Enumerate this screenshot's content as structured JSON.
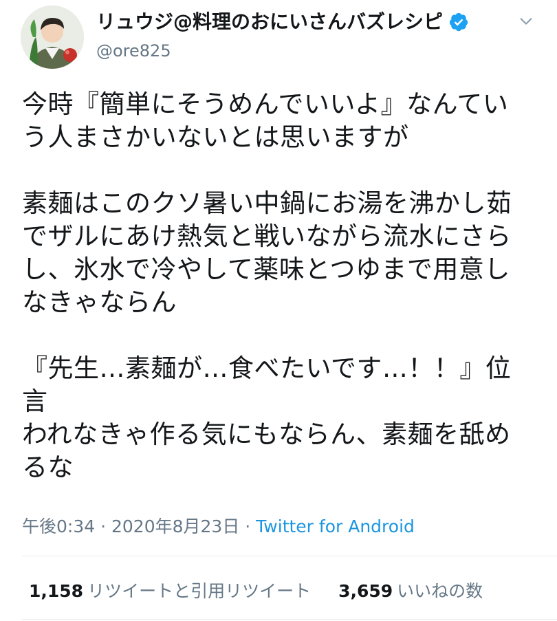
{
  "user": {
    "display_name": "リュウジ@料理のおにいさんバズレシピ",
    "handle": "@ore825",
    "verified": true
  },
  "tweet": {
    "paragraphs": [
      [
        "今時『簡単にそうめんでいいよ』なんてい",
        "う人まさかいないとは思いますが"
      ],
      [
        "素麺はこのクソ暑い中鍋にお湯を沸かし茹",
        "でザルにあけ熱気と戦いながら流水にさら",
        "し、氷水で冷やして薬味とつゆまで用意し",
        "なきゃならん"
      ],
      [
        "『先生…素麺が…食べたいです…！！』位言",
        "われなきゃ作る気にもならん、素麺を舐め",
        "るな"
      ]
    ]
  },
  "meta": {
    "time": "午後0:34",
    "date": "2020年8月23日",
    "separator": " · ",
    "source": "Twitter for Android"
  },
  "stats": {
    "retweets": {
      "count": "1,158",
      "label": "リツイートと引用リツイート"
    },
    "likes": {
      "count": "3,659",
      "label": "いいねの数"
    }
  },
  "colors": {
    "text": "#14171a",
    "secondary": "#657786",
    "link": "#1b95e0",
    "verified": "#1da1f2",
    "divider": "#e6ecf0"
  },
  "icons": {
    "verified": "verified-badge-icon",
    "menu": "chevron-down-icon"
  }
}
